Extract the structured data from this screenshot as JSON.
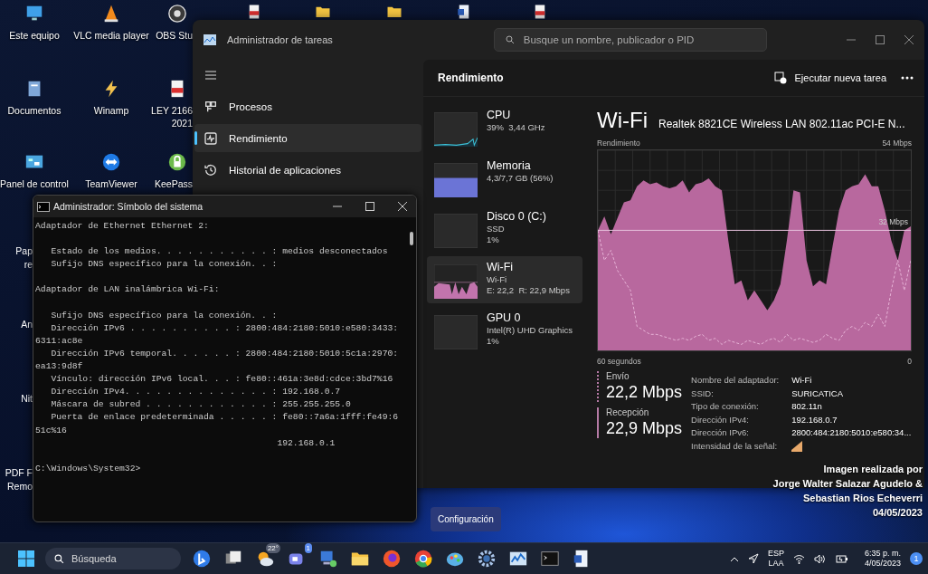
{
  "desktop_icons": [
    {
      "label": "Este equipo",
      "kind": "computer"
    },
    {
      "label": "VLC media player",
      "kind": "cone"
    },
    {
      "label": "OBS Stu",
      "kind": "ring"
    },
    {
      "label": "Documentos",
      "kind": "documents"
    },
    {
      "label": "Winamp",
      "kind": "bolt"
    },
    {
      "label": "LEY 2166\n2021",
      "kind": "pdf"
    },
    {
      "label": "Panel de control",
      "kind": "panel"
    },
    {
      "label": "TeamViewer",
      "kind": "arrows"
    },
    {
      "label": "KeePass",
      "kind": "lock"
    }
  ],
  "top_row_icons": [
    {
      "kind": "pdf"
    },
    {
      "kind": "folder"
    },
    {
      "kind": "folder"
    },
    {
      "kind": "word"
    },
    {
      "kind": "pdf"
    }
  ],
  "hidden_icon_labels": [
    "Pap",
    "re",
    "An",
    "Nit",
    "PDF F",
    "Remo"
  ],
  "task_manager": {
    "title": "Administrador de tareas",
    "search": {
      "placeholder": "Busque un nombre, publicador o PID"
    },
    "nav": [
      {
        "label": "Procesos",
        "kind": "processes",
        "selected": false
      },
      {
        "label": "Rendimiento",
        "kind": "performance",
        "selected": true
      },
      {
        "label": "Historial de aplicaciones",
        "kind": "history",
        "selected": false
      }
    ],
    "settings_button": "Configuración",
    "header": "Rendimiento",
    "run_task": "Ejecutar nueva tarea",
    "devices": [
      {
        "name": "CPU",
        "kind": "cpu",
        "lines": [
          "39%  3,44 GHz"
        ],
        "selected": false
      },
      {
        "name": "Memoria",
        "kind": "memory",
        "lines": [
          "4,3/7,7 GB (56%)"
        ],
        "selected": false
      },
      {
        "name": "Disco 0 (C:)",
        "kind": "disk",
        "lines": [
          "SSD",
          "1%"
        ],
        "selected": false
      },
      {
        "name": "Wi-Fi",
        "kind": "network",
        "lines": [
          "Wi-Fi",
          "E: 22,2  R: 22,9 Mbps"
        ],
        "selected": true
      },
      {
        "name": "GPU 0",
        "kind": "gpu",
        "lines": [
          "Intel(R) UHD Graphics",
          "1%"
        ],
        "selected": false
      }
    ],
    "detail": {
      "title": "Wi-Fi",
      "adapter": "Realtek 8821CE Wireless LAN 802.11ac PCI-E N...",
      "chart_label": "Rendimiento",
      "max_label": "54 Mbps",
      "line_label": "32 Mbps",
      "x_start": "60 segundos",
      "x_end": "0",
      "send": {
        "label": "Envío",
        "value": "22,2 Mbps"
      },
      "receive": {
        "label": "Recepción",
        "value": "22,9 Mbps"
      },
      "properties": [
        {
          "label": "Nombre del adaptador:",
          "kind": "text",
          "value": "Wi-Fi"
        },
        {
          "label": "SSID:",
          "kind": "text",
          "value": "SURICATICA"
        },
        {
          "label": "Tipo de conexión:",
          "kind": "text",
          "value": "802.11n"
        },
        {
          "label": "Dirección IPv4:",
          "kind": "text",
          "value": "192.168.0.7"
        },
        {
          "label": "Dirección IPv6:",
          "kind": "text",
          "value": "2800:484:2180:5010:e580:34..."
        },
        {
          "label": "Intensidad de la señal:",
          "kind": "signal"
        }
      ]
    }
  },
  "cmd": {
    "title": "Administrador: Símbolo del sistema",
    "blocks": [
      [
        "Adaptador de Ethernet Ethernet 2:"
      ],
      [
        "   Estado de los medios. . . . . . . . . . . : medios desconectados",
        "   Sufijo DNS específico para la conexión. . :"
      ],
      [
        "Adaptador de LAN inalámbrica Wi-Fi:"
      ],
      [
        "   Sufijo DNS específico para la conexión. . :",
        "   Dirección IPv6 . . . . . . . . . . : 2800:484:2180:5010:e580:3433:",
        "6311:ac8e",
        "   Dirección IPv6 temporal. . . . . . : 2800:484:2180:5010:5c1a:2970:",
        "ea13:9d8f",
        "   Vínculo: dirección IPv6 local. . . : fe80::461a:3e8d:cdce:3bd7%16",
        "   Dirección IPv4. . . . . . . . . . . . . . : 192.168.0.7",
        "   Máscara de subred . . . . . . . . . . . . : 255.255.255.0",
        "   Puerta de enlace predeterminada . . . . . : fe80::7a6a:1fff:fe49:6",
        "51c%16",
        "                                              192.168.0.1"
      ],
      [
        "C:\\Windows\\System32>"
      ]
    ]
  },
  "credits": [
    "Imagen realizada por",
    "Jorge Walter Salazar Agudelo &",
    "Sebastian Rios Echeverri",
    "04/05/2023"
  ],
  "taskbar": {
    "search_placeholder": "Búsqueda",
    "apps": [
      {
        "kind": "bing"
      },
      {
        "kind": "taskview"
      },
      {
        "kind": "weather",
        "badge": "22°"
      },
      {
        "kind": "chat",
        "badge": "1"
      },
      {
        "kind": "netapp"
      },
      {
        "kind": "files"
      },
      {
        "kind": "firefox"
      },
      {
        "kind": "chrome"
      },
      {
        "kind": "paint"
      },
      {
        "kind": "settings"
      },
      {
        "kind": "taskmgr"
      },
      {
        "kind": "terminal"
      },
      {
        "kind": "word"
      }
    ],
    "language": "ESP",
    "layout": "LAA",
    "time": "6:35 p. m.",
    "date": "4/05/2023",
    "notifications": "1"
  }
}
